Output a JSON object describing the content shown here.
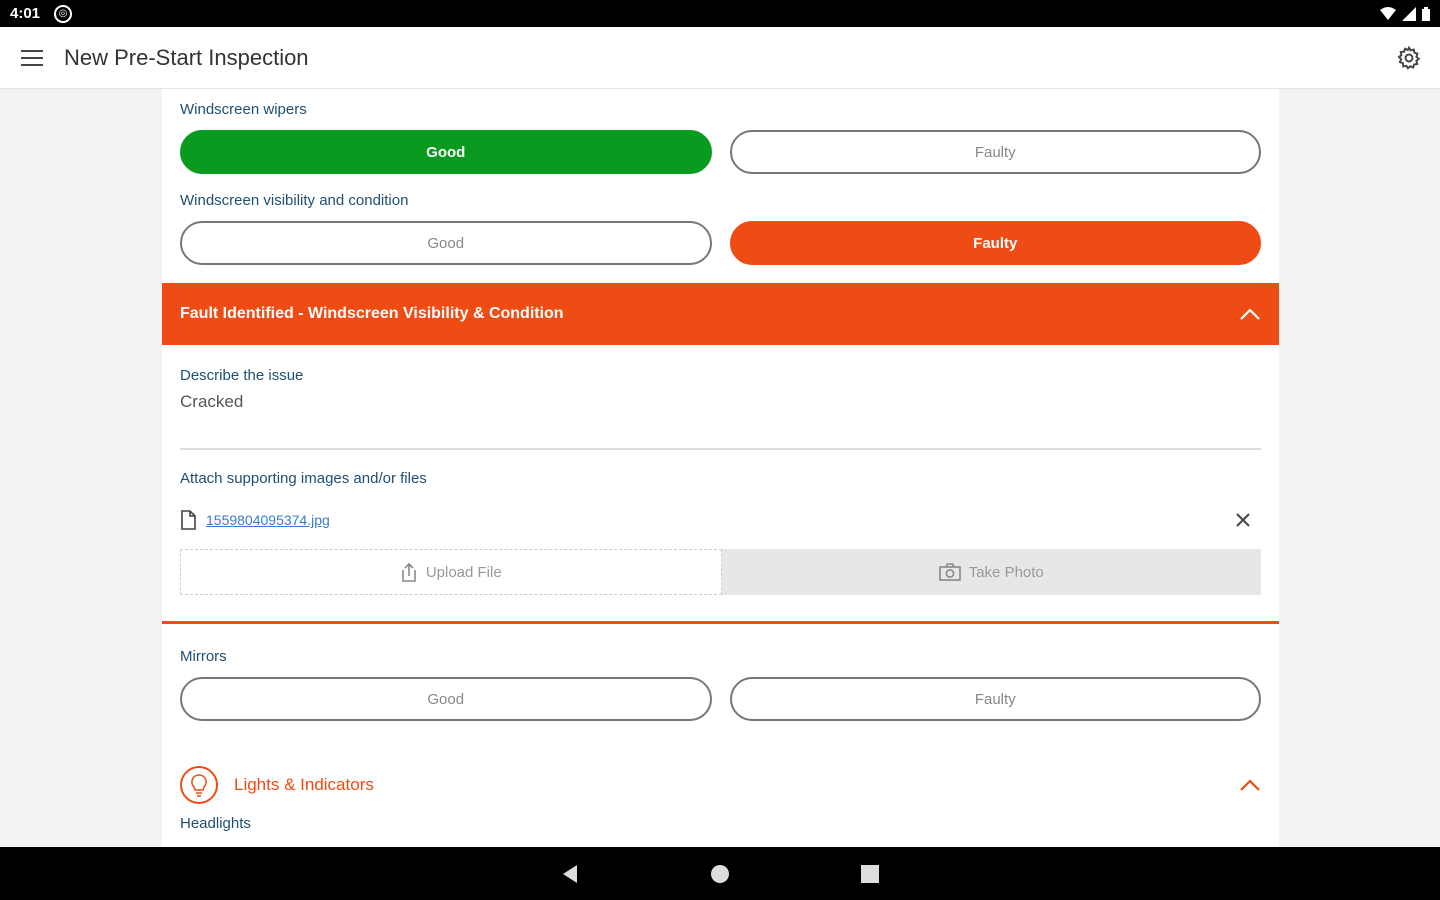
{
  "status_bar": {
    "time": "4:01",
    "notification_icon": "shield-icon"
  },
  "app_bar": {
    "title": "New Pre-Start Inspection"
  },
  "questions": [
    {
      "label": "Windscreen wipers",
      "good_label": "Good",
      "faulty_label": "Faulty",
      "selected": "good"
    },
    {
      "label": "Windscreen visibility and condition",
      "good_label": "Good",
      "faulty_label": "Faulty",
      "selected": "faulty"
    }
  ],
  "fault": {
    "header": "Fault Identified - Windscreen Visibility & Condition",
    "describe_label": "Describe the issue",
    "describe_value": "Cracked",
    "attach_label": "Attach supporting images and/or files",
    "file_name": "1559804095374.jpg",
    "upload_label": "Upload File",
    "photo_label": "Take Photo"
  },
  "mirrors": {
    "label": "Mirrors",
    "good_label": "Good",
    "faulty_label": "Faulty",
    "selected": "none"
  },
  "section": {
    "title": "Lights & Indicators",
    "next_label": "Headlights"
  },
  "colors": {
    "good": "#0b9a20",
    "faulty": "#ee4c14",
    "label": "#1f4f73"
  }
}
